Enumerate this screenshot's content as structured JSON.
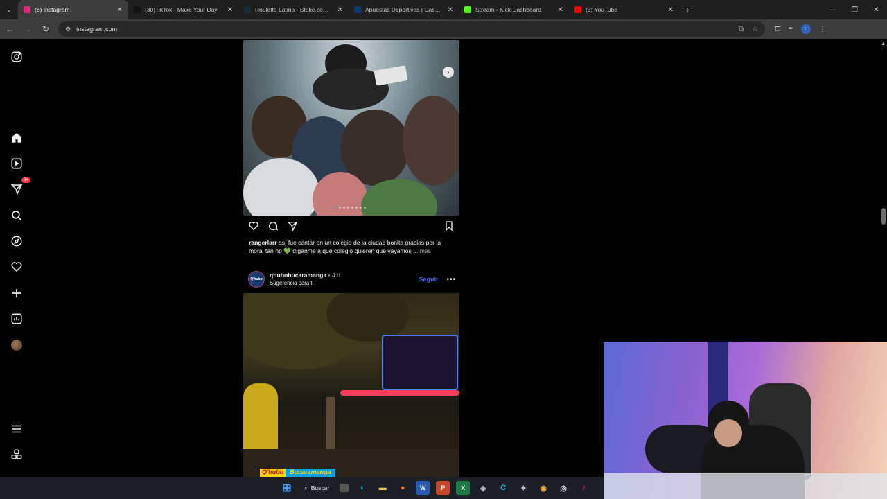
{
  "browser": {
    "tabs": [
      {
        "title": "(6) Instagram",
        "active": true,
        "favicon_color": "#dd2a7b"
      },
      {
        "title": "(30)TikTok - Make Your Day",
        "active": false,
        "favicon_color": "#111111"
      },
      {
        "title": "Roulette Latina - Stake.com.co",
        "active": false,
        "favicon_color": "#1a2c38"
      },
      {
        "title": "Apuestas Deportivas | Casa de ...",
        "active": false,
        "favicon_color": "#0b3a6e"
      },
      {
        "title": "Stream - Kick Dashboard",
        "active": false,
        "favicon_color": "#53fc18"
      },
      {
        "title": "(3) YouTube",
        "active": false,
        "favicon_color": "#ff0000"
      }
    ],
    "url": "instagram.com",
    "profile_initial": "L"
  },
  "sidebar": {
    "notifications_badge": "9+",
    "items": [
      "instagram-logo",
      "home",
      "reels",
      "messages",
      "search",
      "explore",
      "notifications",
      "create",
      "dashboard",
      "profile",
      "more",
      "also-from-meta"
    ]
  },
  "post1": {
    "username": "rangerlarr",
    "caption": "así fue cantar en un colegio de la ciudad bonita gracias por la moral tan hp 💚 díganme a qué colegio quieren que vayamos ...",
    "more_label": "más",
    "carousel_count": 8,
    "carousel_index": 1
  },
  "post2": {
    "username": "qhubobucaramanga",
    "age": "4 d",
    "subtitle": "Sugerencia para ti",
    "follow_label": "Seguir",
    "logo_left": "Q'hubo",
    "logo_right": "Bucaramanga"
  },
  "taskbar": {
    "search_label": "Buscar"
  },
  "colors": {
    "accent_blue": "#4a5df9",
    "badge_red": "#ff3040",
    "background": "#000000"
  }
}
